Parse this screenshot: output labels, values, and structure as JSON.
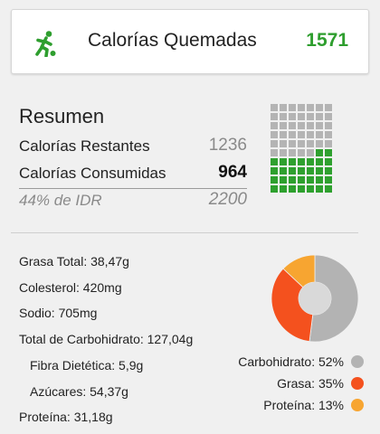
{
  "burned": {
    "icon": "running-person-icon",
    "label": "Calorías Quemadas",
    "value": "1571",
    "value_color": "#2e9e2e"
  },
  "summary": {
    "title": "Resumen",
    "remaining_label": "Calorías Restantes",
    "remaining_value": "1236",
    "consumed_label": "Calorías Consumidas",
    "consumed_value": "964",
    "rdi_label": "44% de IDR",
    "rdi_value": "2200"
  },
  "waffle": {
    "total_cells": 70,
    "filled_cells": 30,
    "filled_color": "#2ea02e",
    "empty_color": "#b4b4b4"
  },
  "nutrients": [
    {
      "label": "Grasa Total: 38,47g"
    },
    {
      "label": "Colesterol: 420mg"
    },
    {
      "label": "Sodio: 705mg"
    },
    {
      "label": "Total de Carbohidrato: 127,04g"
    },
    {
      "label": "Fibra Dietética: 5,9g"
    },
    {
      "label": "Azúcares: 54,37g"
    },
    {
      "label": "Proteína: 31,18g"
    }
  ],
  "chart_data": {
    "type": "pie",
    "categories": [
      "Carbohidrato",
      "Grasa",
      "Proteína"
    ],
    "values": [
      52,
      35,
      13
    ],
    "colors": [
      "#b3b3b3",
      "#f4511e",
      "#f7a531"
    ],
    "legend": [
      {
        "label": "Carbohidrato: 52%"
      },
      {
        "label": "Grasa: 35%"
      },
      {
        "label": "Proteína: 13%"
      }
    ]
  }
}
